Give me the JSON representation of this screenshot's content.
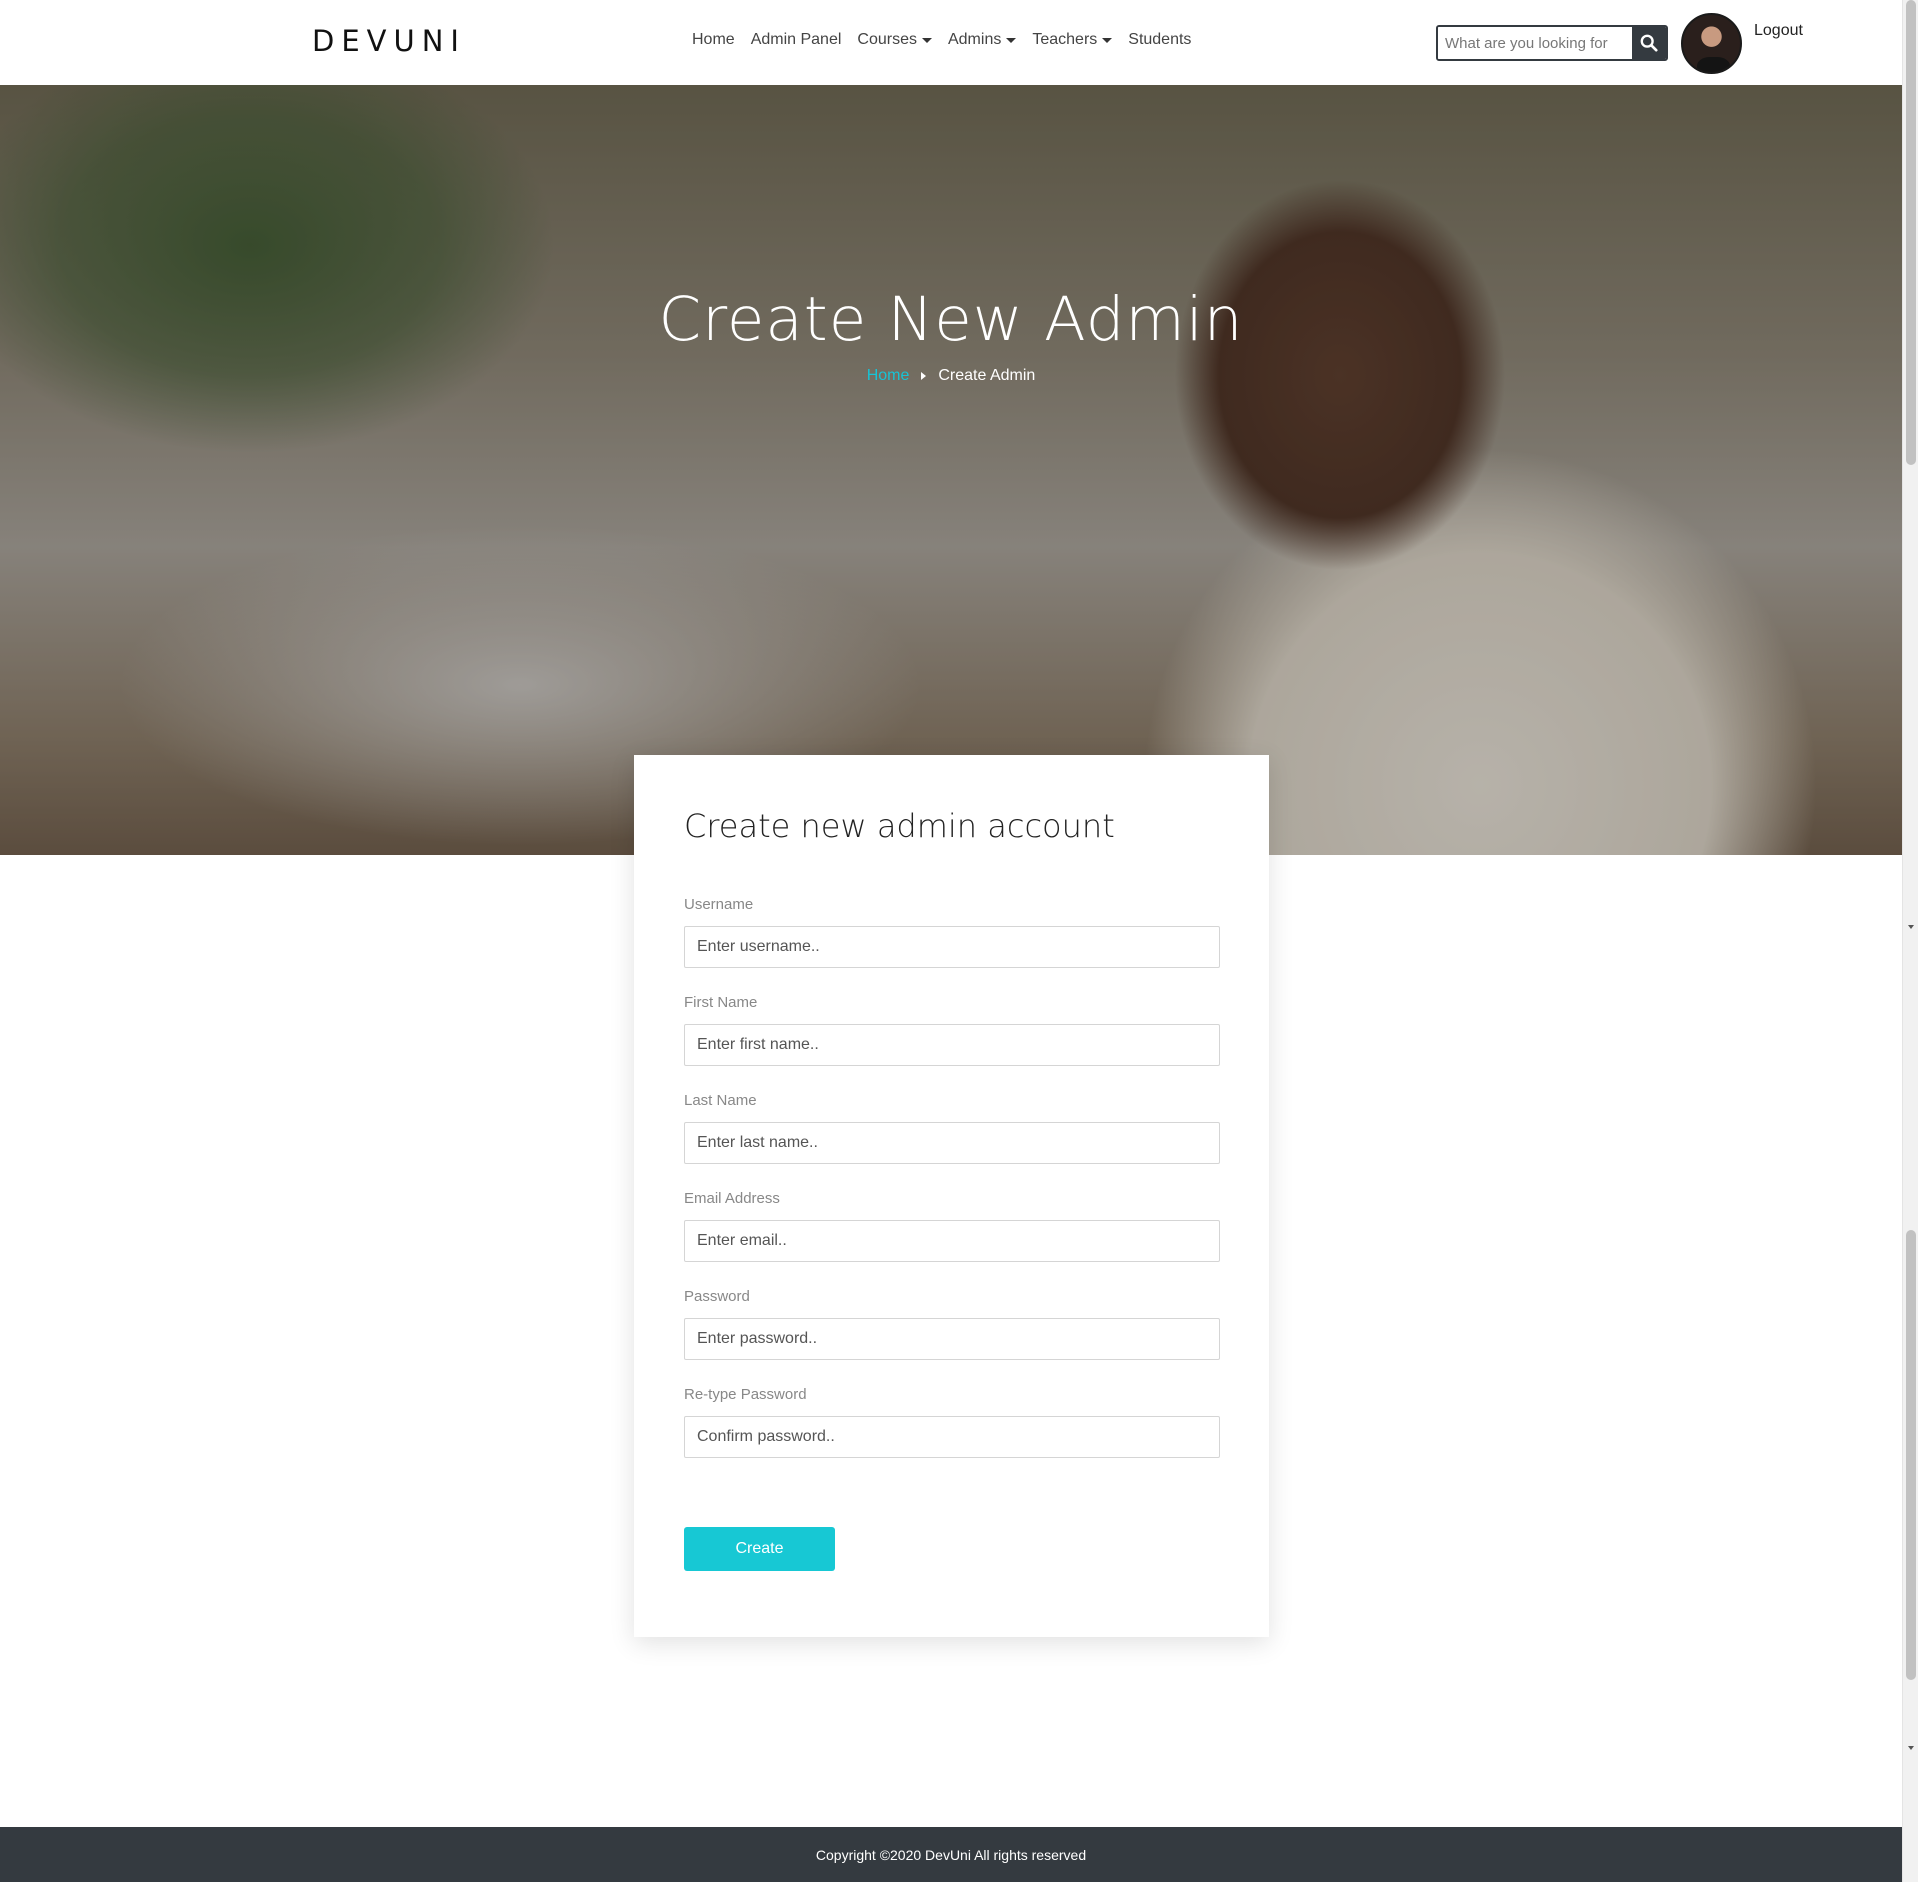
{
  "brand": "DEVUNI",
  "nav": {
    "items": [
      {
        "label": "Home",
        "dropdown": false
      },
      {
        "label": "Admin Panel",
        "dropdown": false
      },
      {
        "label": "Courses",
        "dropdown": true
      },
      {
        "label": "Admins",
        "dropdown": true
      },
      {
        "label": "Teachers",
        "dropdown": true
      },
      {
        "label": "Students",
        "dropdown": false
      }
    ],
    "search_placeholder": "What are you looking for",
    "search_icon": "search-icon",
    "logout_label": "Logout"
  },
  "hero": {
    "title": "Create New Admin",
    "breadcrumb": {
      "home": "Home",
      "current": "Create Admin"
    }
  },
  "form": {
    "title": "Create new admin account",
    "fields": [
      {
        "label": "Username",
        "placeholder": "Enter username.."
      },
      {
        "label": "First Name",
        "placeholder": "Enter first name.."
      },
      {
        "label": "Last Name",
        "placeholder": "Enter last name.."
      },
      {
        "label": "Email Address",
        "placeholder": "Enter email.."
      },
      {
        "label": "Password",
        "placeholder": "Enter password.."
      },
      {
        "label": "Re-type Password",
        "placeholder": "Confirm password.."
      }
    ],
    "submit_label": "Create"
  },
  "footer": {
    "copyright": "Copyright ©2020 DevUni All rights reserved"
  },
  "colors": {
    "accent": "#17c8d4",
    "dark": "#343a40"
  }
}
